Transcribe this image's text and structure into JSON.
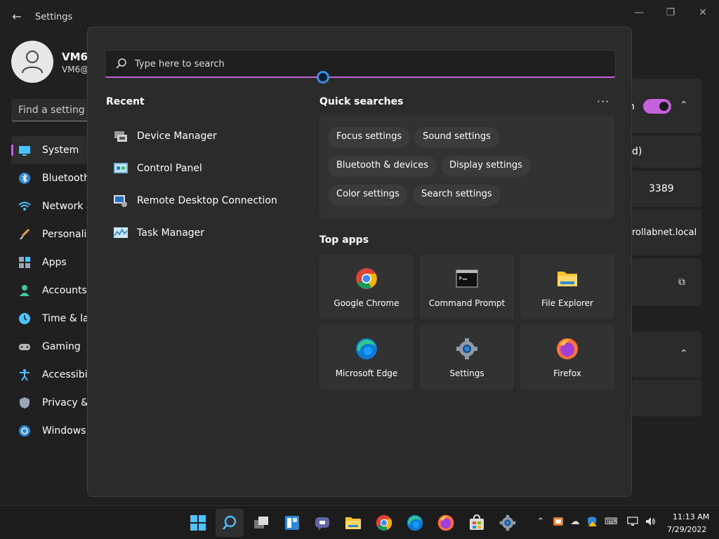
{
  "settings": {
    "title": "Settings",
    "user_name": "VM6",
    "user_email": "VM6@",
    "find_placeholder": "Find a setting",
    "nav": [
      {
        "label": "System",
        "icon": "system-icon"
      },
      {
        "label": "Bluetooth",
        "icon": "bluetooth-icon"
      },
      {
        "label": "Network &",
        "icon": "network-icon"
      },
      {
        "label": "Personaliz",
        "icon": "personalization-icon"
      },
      {
        "label": "Apps",
        "icon": "apps-icon"
      },
      {
        "label": "Accounts",
        "icon": "accounts-icon"
      },
      {
        "label": "Time & lar",
        "icon": "time-language-icon"
      },
      {
        "label": "Gaming",
        "icon": "gaming-icon"
      },
      {
        "label": "Accessibili",
        "icon": "accessibility-icon"
      },
      {
        "label": "Privacy & s",
        "icon": "privacy-icon"
      },
      {
        "label": "Windows U",
        "icon": "windows-update-icon"
      }
    ],
    "panel": {
      "card1_suffix": "n",
      "card2_text": "d)",
      "card3_text": "3389",
      "card4_text": "rollabnet.local"
    }
  },
  "search": {
    "placeholder": "Type here to search",
    "recent_title": "Recent",
    "recent": [
      {
        "label": "Device Manager",
        "icon": "device-manager-icon"
      },
      {
        "label": "Control Panel",
        "icon": "control-panel-icon"
      },
      {
        "label": "Remote Desktop Connection",
        "icon": "remote-desktop-icon"
      },
      {
        "label": "Task Manager",
        "icon": "task-manager-icon"
      }
    ],
    "quick_title": "Quick searches",
    "more_label": "···",
    "quick_searches": [
      "Focus settings",
      "Sound settings",
      "Bluetooth & devices",
      "Display settings",
      "Color settings",
      "Search settings"
    ],
    "top_apps_title": "Top apps",
    "top_apps": [
      {
        "label": "Google Chrome",
        "icon": "chrome-icon"
      },
      {
        "label": "Command Prompt",
        "icon": "command-prompt-icon"
      },
      {
        "label": "File Explorer",
        "icon": "file-explorer-icon"
      },
      {
        "label": "Microsoft Edge",
        "icon": "edge-icon"
      },
      {
        "label": "Settings",
        "icon": "settings-icon"
      },
      {
        "label": "Firefox",
        "icon": "firefox-icon"
      }
    ]
  },
  "taskbar": {
    "time": "11:13 AM",
    "date": "7/29/2022"
  },
  "colors": {
    "accent": "#c561d9",
    "background": "#202020",
    "flyout": "#2b2b2b"
  }
}
